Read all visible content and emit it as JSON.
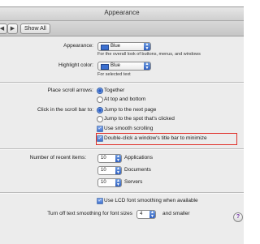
{
  "window": {
    "title": "Appearance"
  },
  "toolbar": {
    "back_symbol": "◀",
    "forward_symbol": "▶",
    "show_all_label": "Show All"
  },
  "appearance": {
    "label": "Appearance:",
    "value": "Blue",
    "help": "For the overall look of buttons, menus, and windows"
  },
  "highlight": {
    "label": "Highlight color:",
    "value": "Blue",
    "help": "For selected text"
  },
  "scroll_arrows": {
    "label": "Place scroll arrows:",
    "options": [
      "Together",
      "At top and bottom"
    ],
    "selected": "Together"
  },
  "scroll_bar": {
    "label": "Click in the scroll bar to:",
    "options": [
      "Jump to the next page",
      "Jump to the spot that's clicked"
    ],
    "selected": "Jump to the next page"
  },
  "checkboxes": {
    "smooth_scrolling": "Use smooth scrolling",
    "double_click_minimize": "Double-click a window's title bar to minimize"
  },
  "recent": {
    "label": "Number of recent items:",
    "rows": [
      {
        "value": "10",
        "label": "Applications"
      },
      {
        "value": "10",
        "label": "Documents"
      },
      {
        "value": "10",
        "label": "Servers"
      }
    ]
  },
  "lcd": {
    "label": "Use LCD font smoothing when available"
  },
  "smoothing": {
    "label": "Turn off text smoothing for font sizes",
    "value": "4",
    "suffix": "and smaller"
  },
  "help": {
    "symbol": "?"
  },
  "colors": {
    "accent": "#3b6fd0",
    "highlight_frame": "#e0302a"
  }
}
